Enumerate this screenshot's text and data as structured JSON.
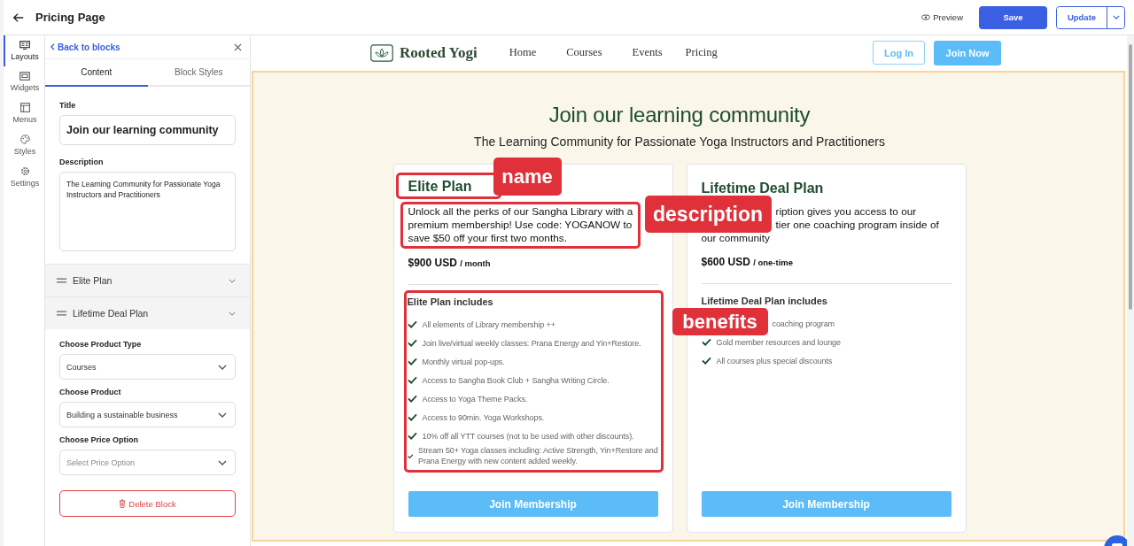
{
  "topbar": {
    "title": "Pricing Page",
    "preview": "Preview",
    "save": "Save",
    "update": "Update"
  },
  "rail": [
    {
      "label": "Layouts",
      "selected": true
    },
    {
      "label": "Widgets",
      "selected": false
    },
    {
      "label": "Menus",
      "selected": false
    },
    {
      "label": "Styles",
      "selected": false
    },
    {
      "label": "Settings",
      "selected": false
    }
  ],
  "panel": {
    "back": "Back to blocks",
    "tabs": [
      {
        "label": "Content",
        "selected": true
      },
      {
        "label": "Block Styles",
        "selected": false
      }
    ],
    "title_label": "Title",
    "title_value": "Join our learning community",
    "description_label": "Description",
    "description_value": "The Learning Community for Passionate Yoga Instructors and Practitioners",
    "plans": [
      {
        "label": "Elite Plan",
        "expanded": false
      },
      {
        "label": "Lifetime Deal Plan",
        "expanded": false
      }
    ],
    "selects": [
      {
        "label": "Choose Product Type",
        "value": "Courses"
      },
      {
        "label": "Choose Product",
        "value": "Building a sustainable business"
      },
      {
        "label": "Choose Price Option",
        "placeholder": "Select Price Option"
      }
    ],
    "delete": "Delete Block"
  },
  "site": {
    "logo": "Rooted Yogi",
    "nav": [
      "Home",
      "Courses",
      "Events",
      "Pricing"
    ],
    "login": "Log In",
    "join": "Join Now"
  },
  "section": {
    "title": "Join our learning community",
    "subtitle": "The Learning Community for Passionate Yoga Instructors and Practitioners"
  },
  "cards": [
    {
      "name": "Elite Plan",
      "highlighted": true,
      "description": [
        {
          "text": "Unlock all the perks of our Sangha Library with a premium membership! Use code: YOGANOW to save $50 off your first two months.",
          "covered": false
        }
      ],
      "price": "$900 USD",
      "period": "/ month",
      "includes": "Elite Plan includes",
      "benefits": [
        {
          "text": "All elements of Library membership ++",
          "covered": false
        },
        {
          "text": "Join live/virtual weekly classes: Prana Energy and Yin+Restore.",
          "covered": false
        },
        {
          "text": "Monthly virtual pop-ups.",
          "covered": false
        },
        {
          "text": "Access to Sangha Book Club + Sangha Writing Circle.",
          "covered": false
        },
        {
          "text": "Access to Yoga Theme Packs.",
          "covered": false
        },
        {
          "text": "Access to 90min. Yoga Workshops.",
          "covered": false
        },
        {
          "text": "10% off all YTT courses (not to be used with other discounts).",
          "covered": false
        },
        {
          "text": "Stream 50+ Yoga classes including: Active Strength, Yin+Restore and Prana Energy with new content added weekly.",
          "covered": false
        }
      ],
      "button": "Join Membership"
    },
    {
      "name": "Lifetime Deal Plan",
      "highlighted": false,
      "description": [
        {
          "text": "ription gives you access to our",
          "covered": true
        },
        {
          "text": "tier one coaching program inside of",
          "covered": true
        },
        {
          "text": "our community",
          "covered": false
        }
      ],
      "price": "$600 USD",
      "period": "/ one-time",
      "includes": "Lifetime Deal Plan includes",
      "benefits": [
        {
          "text": "coaching program",
          "covered": true
        },
        {
          "text": "Gold member resources and lounge",
          "covered": false
        },
        {
          "text": "All courses plus special discounts",
          "covered": false
        }
      ],
      "button": "Join Membership"
    }
  ],
  "annotations": [
    {
      "label": "name"
    },
    {
      "label": "description"
    },
    {
      "label": "benefits"
    }
  ]
}
